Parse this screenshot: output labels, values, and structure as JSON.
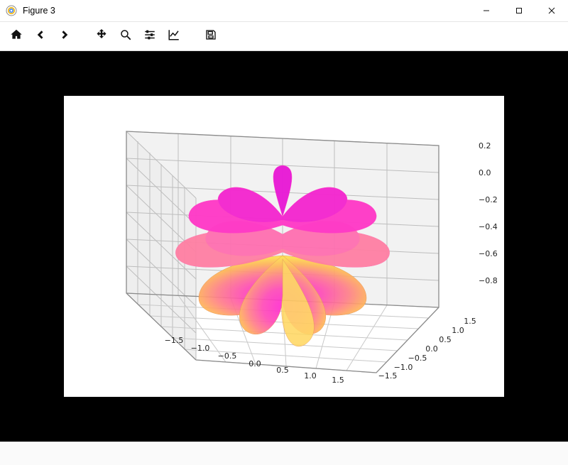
{
  "window": {
    "title": "Figure 3"
  },
  "toolbar": {
    "home": "Home",
    "back": "Back",
    "forward": "Forward",
    "pan": "Pan",
    "zoom": "Zoom",
    "subplots": "Configure subplots",
    "edit": "Edit axis",
    "save": "Save"
  },
  "chart_data": {
    "type": "surface-3d",
    "description": "3D parametric flower / rose surface (matplotlib Axes3D) colored with a yellow→orange→pink→magenta colormap by height",
    "x_range": [
      -1.5,
      1.5
    ],
    "y_range": [
      -1.5,
      1.5
    ],
    "z_range": [
      -0.8,
      0.2
    ],
    "x_ticks": [
      -1.5,
      -1.0,
      -0.5,
      0.0,
      0.5,
      1.0,
      1.5
    ],
    "y_ticks": [
      -1.5,
      -1.0,
      -0.5,
      0.0,
      0.5,
      1.0,
      1.5
    ],
    "z_ticks": [
      -0.8,
      -0.6,
      -0.4,
      -0.2,
      0.0,
      0.2
    ],
    "colormap_stops": [
      "#ffe84a",
      "#ffb454",
      "#ff7c8c",
      "#ff3bc7",
      "#e41bd6"
    ],
    "view": {
      "elev_approx": 25,
      "azim_approx": -60
    },
    "grid": true,
    "background_pane": "#f2f2f2"
  }
}
